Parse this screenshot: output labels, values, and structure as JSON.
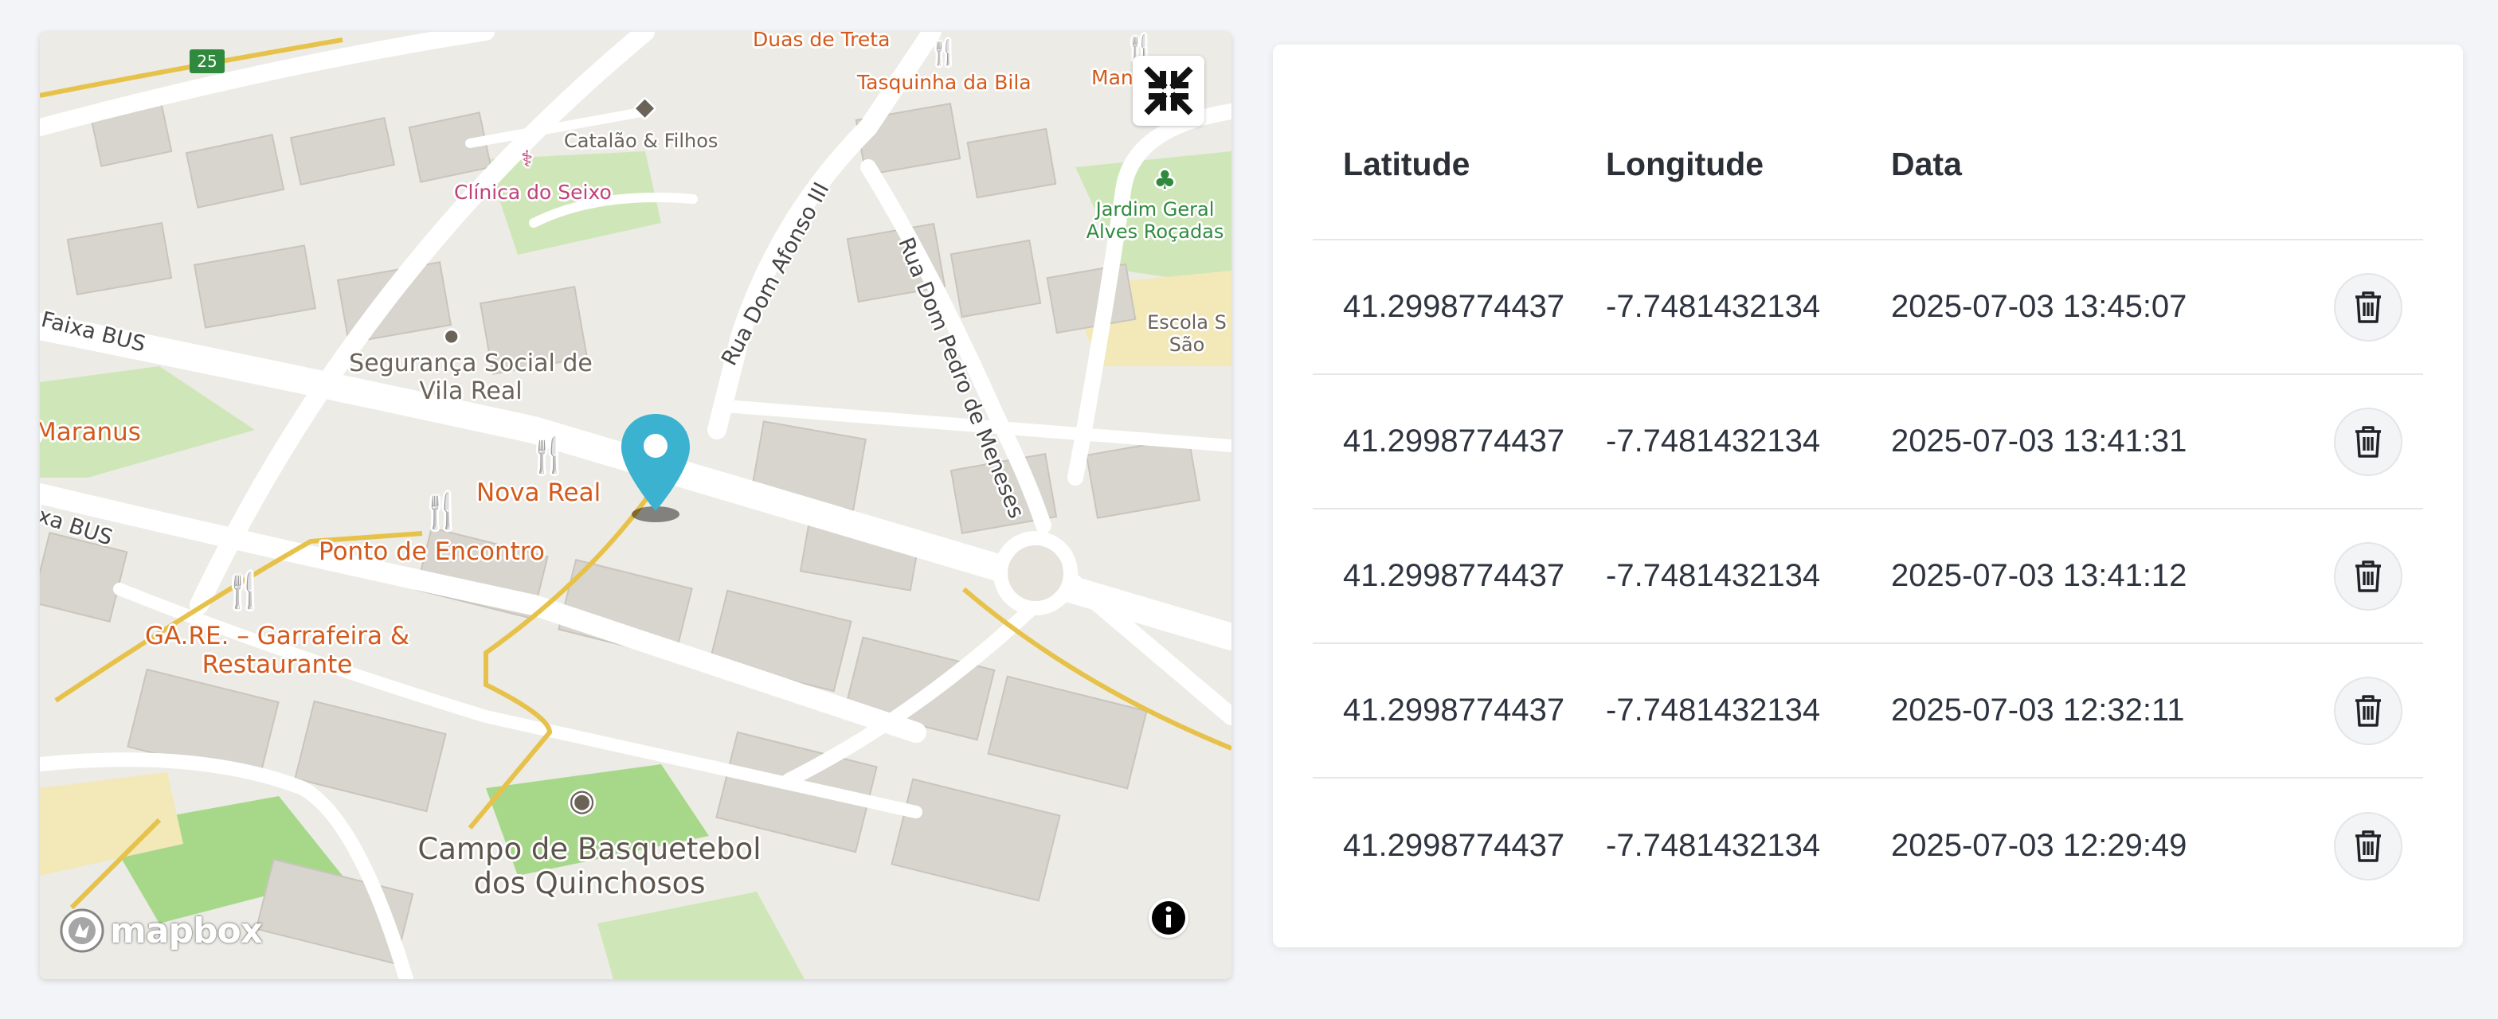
{
  "map": {
    "labels": {
      "duas_de_treta": "Duas de Treta",
      "tasquinha": "Tasquinha da Bila",
      "mane": "Mane",
      "catalao": "Catalão & Filhos",
      "clinica": "Clínica do Seixo",
      "jardim": "Jardim Geral Alves Roçadas",
      "escola": "Escola S São",
      "faixa_bus_1": "Faixa BUS",
      "faixa_bus_2": "ixa BUS",
      "seguranca": "Segurança Social de Vila Real",
      "maranus": "Maranus",
      "nova_real": "Nova Real",
      "ponto_encontro": "Ponto de Encontro",
      "gare": "GA.RE. – Garrafeira & Restaurante",
      "campo": "Campo de Basquetebol dos Quinchosos",
      "rua_afonso": "Rua Dom Afonso III",
      "rua_pedro": "Rua Dom Pedro de Meneses",
      "road_shield": "25"
    },
    "logo_text": "mapbox",
    "colors": {
      "marker": "#3bb2d0",
      "poi": "#d35a1c",
      "park": "#c9e8b0"
    }
  },
  "table": {
    "headers": {
      "lat": "Latitude",
      "lon": "Longitude",
      "date": "Data"
    },
    "rows": [
      {
        "lat": "41.2998774437",
        "lon": "-7.7481432134",
        "date": "2025-07-03 13:45:07"
      },
      {
        "lat": "41.2998774437",
        "lon": "-7.7481432134",
        "date": "2025-07-03 13:41:31"
      },
      {
        "lat": "41.2998774437",
        "lon": "-7.7481432134",
        "date": "2025-07-03 13:41:12"
      },
      {
        "lat": "41.2998774437",
        "lon": "-7.7481432134",
        "date": "2025-07-03 12:32:11"
      },
      {
        "lat": "41.2998774437",
        "lon": "-7.7481432134",
        "date": "2025-07-03 12:29:49"
      }
    ],
    "action_icon": "trash-icon"
  }
}
